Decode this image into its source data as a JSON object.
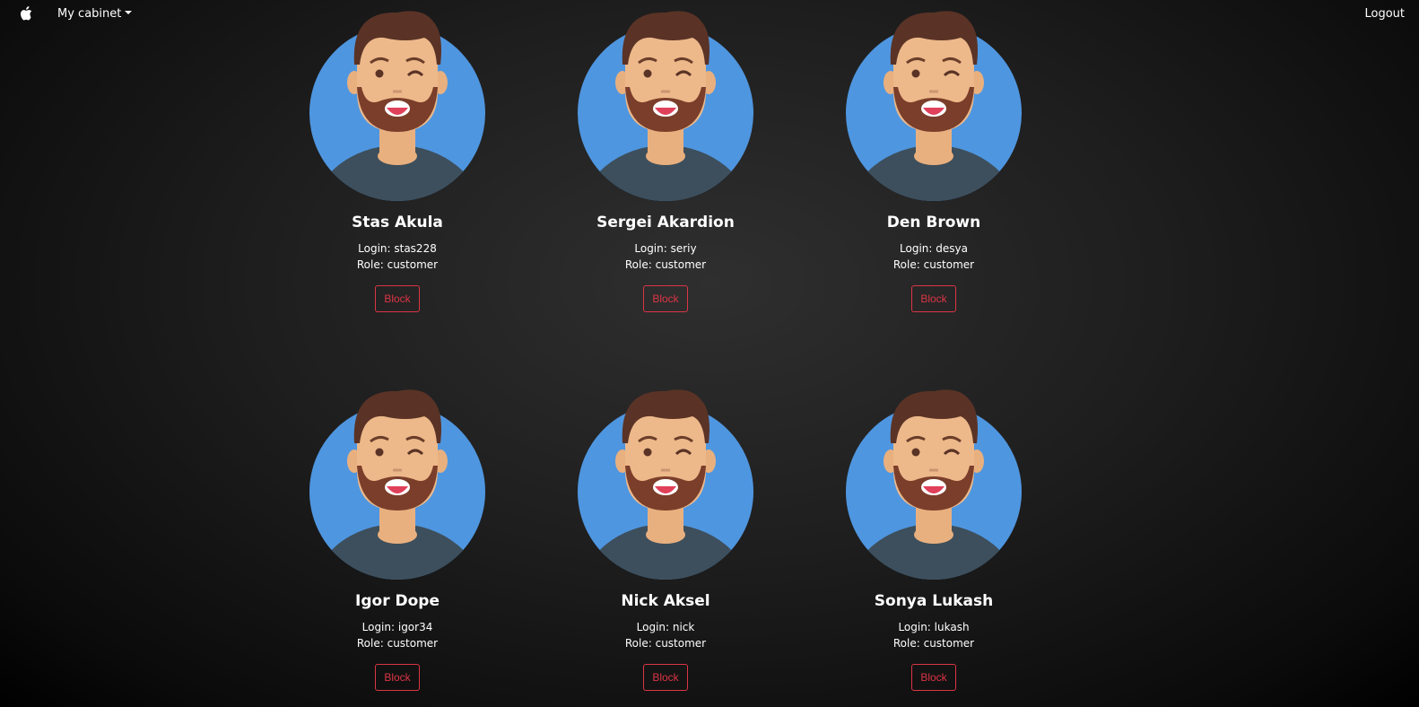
{
  "nav": {
    "brand_icon": "apple-icon",
    "cabinet": "My cabinet",
    "logout": "Logout"
  },
  "colors": {
    "danger": "#dc3545",
    "avatar_bg": "#4f96e0"
  },
  "users": [
    {
      "name": "Stas Akula",
      "login": "Login: stas228",
      "role": "Role: customer",
      "action": "Block"
    },
    {
      "name": "Sergei Akardion",
      "login": "Login: seriy",
      "role": "Role: customer",
      "action": "Block"
    },
    {
      "name": "Den Brown",
      "login": "Login: desya",
      "role": "Role: customer",
      "action": "Block"
    },
    {
      "name": "Igor Dope",
      "login": "Login: igor34",
      "role": "Role: customer",
      "action": "Block"
    },
    {
      "name": "Nick Aksel",
      "login": "Login: nick",
      "role": "Role: customer",
      "action": "Block"
    },
    {
      "name": "Sonya Lukash",
      "login": "Login: lukash",
      "role": "Role: customer",
      "action": "Block"
    }
  ]
}
